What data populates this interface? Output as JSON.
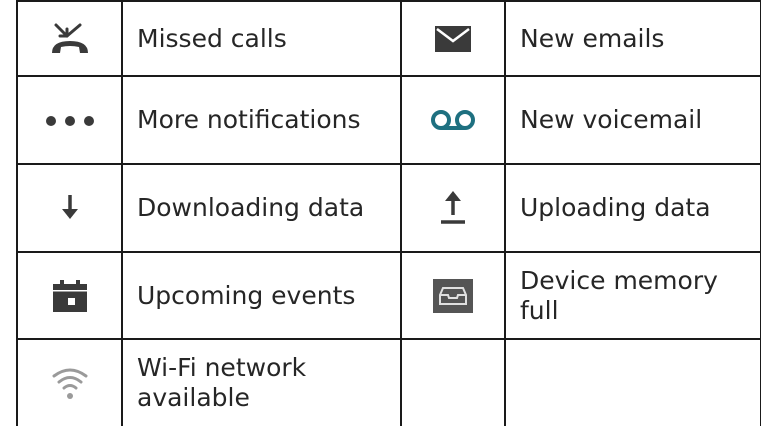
{
  "table": {
    "rows": [
      {
        "left": {
          "icon": "missed-call-icon",
          "label": "Missed calls"
        },
        "right": {
          "icon": "envelope-icon",
          "label": "New emails"
        }
      },
      {
        "left": {
          "icon": "more-dots-icon",
          "label": "More notifications"
        },
        "right": {
          "icon": "voicemail-icon",
          "label": "New voicemail"
        }
      },
      {
        "left": {
          "icon": "download-arrow-icon",
          "label": "Downloading data"
        },
        "right": {
          "icon": "upload-arrow-icon",
          "label": "Uploading data"
        }
      },
      {
        "left": {
          "icon": "calendar-icon",
          "label": "Upcoming events"
        },
        "right": {
          "icon": "storage-full-icon",
          "label": "Device memory full"
        }
      },
      {
        "left": {
          "icon": "wifi-icon",
          "label": "Wi-Fi network available"
        },
        "right": {
          "icon": "",
          "label": ""
        }
      }
    ]
  },
  "colors": {
    "icon_dark": "#3a3a3a",
    "icon_teal": "#1e7080",
    "storage_bg": "#555555",
    "wifi_gray": "#9a9a9a"
  }
}
